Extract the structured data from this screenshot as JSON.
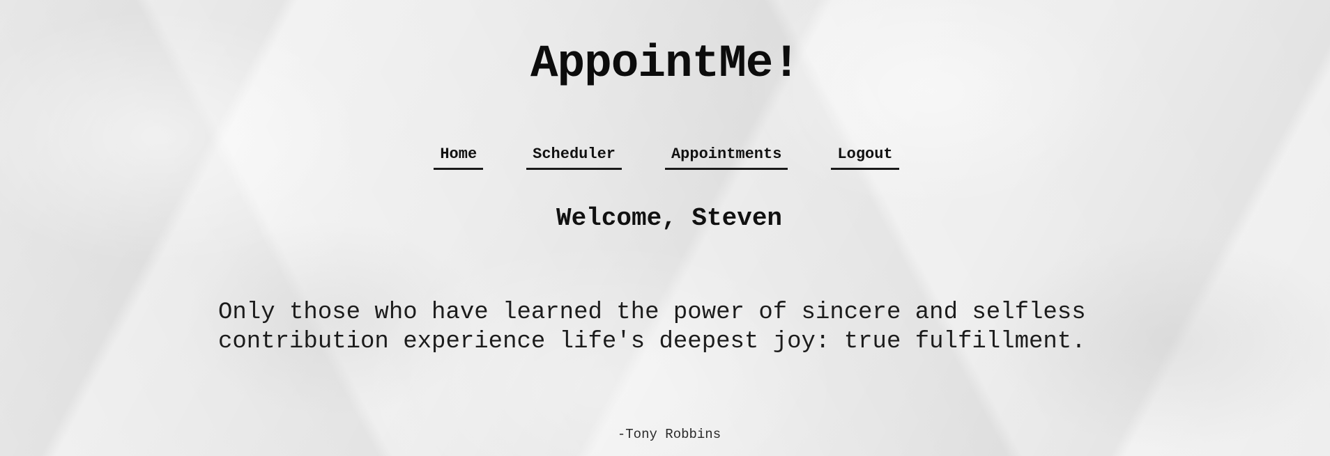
{
  "header": {
    "app_title": "AppointMe!"
  },
  "nav": {
    "items": [
      {
        "label": "Home"
      },
      {
        "label": "Scheduler"
      },
      {
        "label": "Appointments"
      },
      {
        "label": "Logout"
      }
    ]
  },
  "main": {
    "welcome": "Welcome, Steven",
    "quote_text": "Only those who have learned the power of sincere and selfless contribution experience life's deepest joy: true fulfillment.",
    "quote_author": "-Tony Robbins"
  }
}
